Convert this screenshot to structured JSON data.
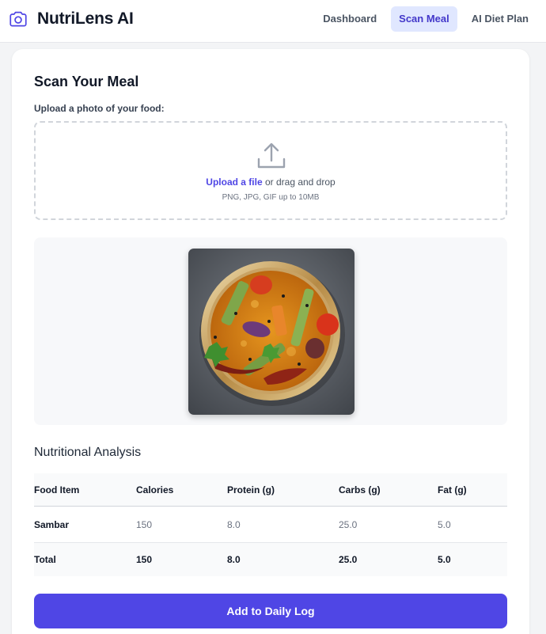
{
  "app": {
    "name": "NutriLens AI",
    "logo_icon": "camera-icon",
    "accent_color": "#4f46e5"
  },
  "nav": {
    "items": [
      {
        "label": "Dashboard",
        "active": false
      },
      {
        "label": "Scan Meal",
        "active": true
      },
      {
        "label": "AI Diet Plan",
        "active": false
      }
    ]
  },
  "scan": {
    "title": "Scan Your Meal",
    "upload_label": "Upload a photo of your food:",
    "dropzone": {
      "icon": "upload-icon",
      "link_text": "Upload a file",
      "drag_text": " or drag and drop",
      "hint": "PNG, JPG, GIF up to 10MB"
    }
  },
  "analysis": {
    "title": "Nutritional Analysis",
    "columns": [
      "Food Item",
      "Calories",
      "Protein (g)",
      "Carbs (g)",
      "Fat (g)"
    ],
    "rows": [
      [
        "Sambar",
        "150",
        "8.0",
        "25.0",
        "5.0"
      ]
    ],
    "total": [
      "Total",
      "150",
      "8.0",
      "25.0",
      "5.0"
    ]
  },
  "actions": {
    "add_label": "Add to Daily Log"
  }
}
